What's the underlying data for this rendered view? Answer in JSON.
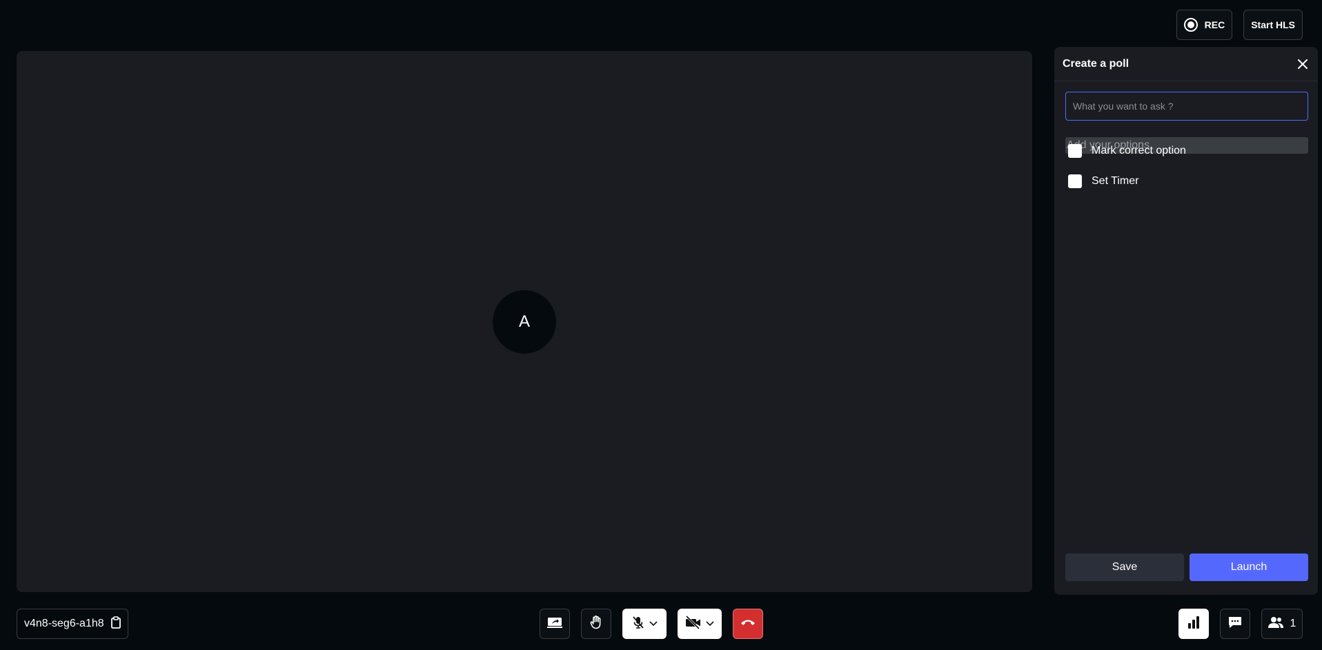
{
  "topbar": {
    "rec_label": "REC",
    "hls_label": "Start HLS"
  },
  "stage": {
    "avatar_initial": "A"
  },
  "poll": {
    "title": "Create a poll",
    "question_placeholder": "What you want to ask ?",
    "question_value": "",
    "options_placeholder": "Add your options",
    "mark_correct_label": "Mark correct option",
    "mark_correct_checked": false,
    "set_timer_label": "Set Timer",
    "set_timer_checked": false,
    "save_label": "Save",
    "launch_label": "Launch"
  },
  "footer": {
    "meeting_id": "v4n8-seg6-a1h8",
    "participants_count": "1"
  },
  "colors": {
    "accent": "#5568fe",
    "end_call": "#d32f2f",
    "panel_bg": "#1a1c22",
    "app_bg": "#050a0e"
  },
  "icons": {
    "rec": "record-icon",
    "close": "close-icon",
    "copy": "clipboard-icon",
    "screen_share": "screen-share-icon",
    "raise_hand": "raise-hand-icon",
    "mic": "mic-off-icon",
    "camera": "camera-off-icon",
    "end_call": "phone-hangup-icon",
    "poll": "bar-chart-icon",
    "chat": "chat-icon",
    "participants": "participants-icon"
  }
}
